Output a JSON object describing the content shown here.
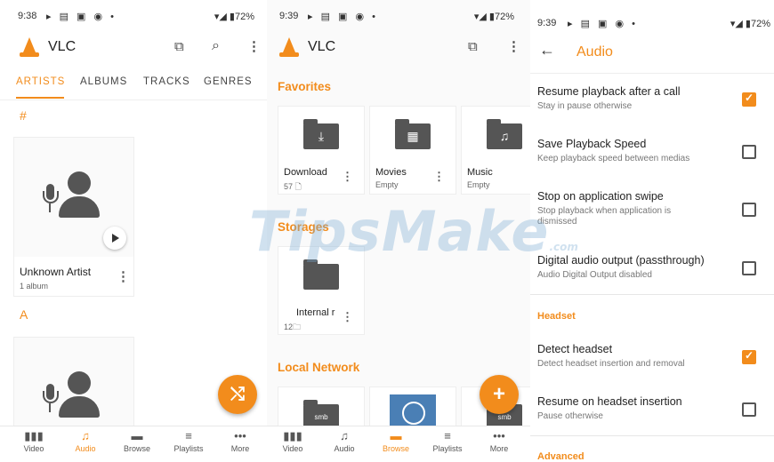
{
  "accent": "#f28c1c",
  "screen1": {
    "status": {
      "time": "9:38",
      "icons": "▸ ▤ ▣ ◉ •",
      "right": "▾◢ ▮72%"
    },
    "app_title": "VLC",
    "tabs": [
      "ARTISTS",
      "ALBUMS",
      "TRACKS",
      "GENRES"
    ],
    "sections": [
      "#",
      "A"
    ],
    "artist": {
      "name": "Unknown Artist",
      "sub": "1 album"
    },
    "fab_icon": "shuffle-icon"
  },
  "screen2": {
    "status": {
      "time": "9:39",
      "icons": "▸ ▤ ▣ ◉ •",
      "right": "▾◢ ▮72%"
    },
    "app_title": "VLC",
    "favorites_title": "Favorites",
    "favorites": [
      {
        "name": "Download",
        "sub": "57 🗋",
        "icon": "download-icon"
      },
      {
        "name": "Movies",
        "sub": "Empty",
        "icon": "film-icon"
      },
      {
        "name": "Music",
        "sub": "Empty",
        "icon": "music-note-icon"
      }
    ],
    "storages_title": "Storages",
    "storage": {
      "name": "Internal r",
      "sub": "12🗀"
    },
    "network_title": "Local Network",
    "network": [
      "smb",
      "smb"
    ]
  },
  "screen3": {
    "status": {
      "time": "9:39",
      "icons": "▸ ▤ ▣ ◉ •",
      "right": "▾◢ ▮72%"
    },
    "title": "Audio",
    "settings": [
      {
        "title": "Resume playback after a call",
        "sub": "Stay in pause otherwise",
        "checked": true
      },
      {
        "title": "Save Playback Speed",
        "sub": "Keep playback speed between medias",
        "checked": false
      },
      {
        "title": "Stop on application swipe",
        "sub": "Stop playback when application is dismissed",
        "checked": false
      },
      {
        "title": "Digital audio output (passthrough)",
        "sub": "Audio Digital Output disabled",
        "checked": false
      }
    ],
    "headset_title": "Headset",
    "headset": [
      {
        "title": "Detect headset",
        "sub": "Detect headset insertion and removal",
        "checked": true
      },
      {
        "title": "Resume on headset insertion",
        "sub": "Pause otherwise",
        "checked": false
      }
    ],
    "advanced_title": "Advanced"
  },
  "nav": [
    {
      "label": "Video",
      "icon": "▮▮▮"
    },
    {
      "label": "Audio",
      "icon": "♫"
    },
    {
      "label": "Browse",
      "icon": "▬"
    },
    {
      "label": "Playlists",
      "icon": "≡"
    },
    {
      "label": "More",
      "icon": "•••"
    }
  ],
  "watermark": {
    "text": "TipsMake",
    "suffix": ".com"
  }
}
